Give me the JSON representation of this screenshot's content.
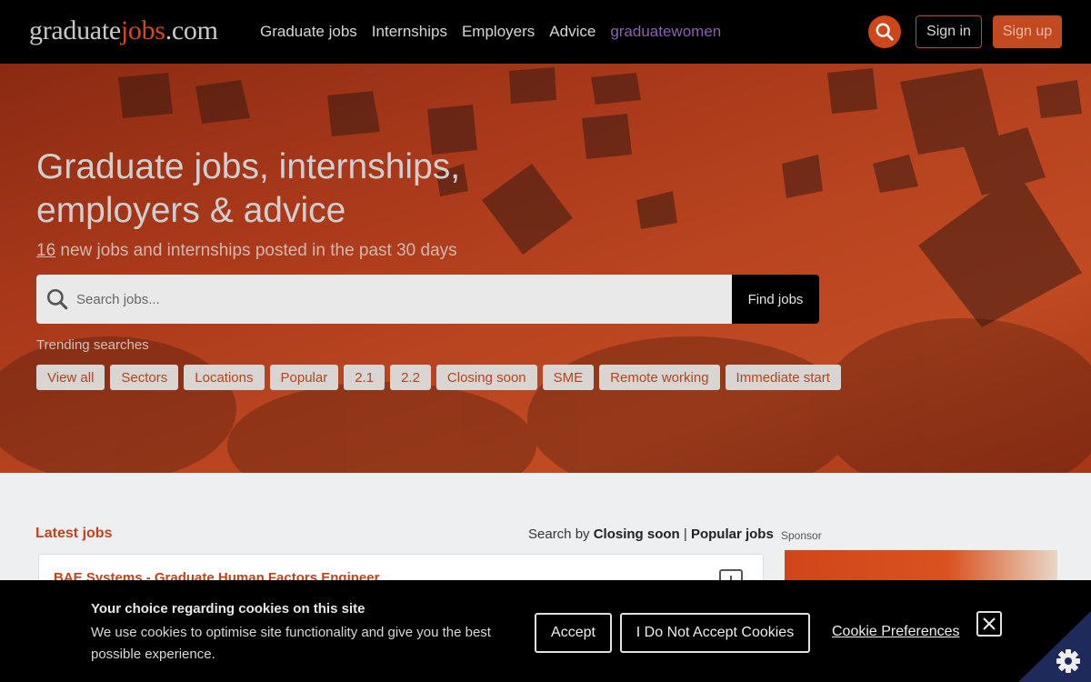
{
  "header": {
    "logo": {
      "part1": "graduate",
      "part2": "jobs",
      "part3": ".com"
    },
    "nav": [
      "Graduate jobs",
      "Internships",
      "Employers",
      "Advice",
      "graduatewomen"
    ],
    "sign_in": "Sign in",
    "sign_up": "Sign up"
  },
  "hero": {
    "title": "Graduate jobs, internships, employers & advice",
    "sub_count": "16",
    "sub_text": " new jobs and internships posted in the past 30 days",
    "search_placeholder": "Search jobs...",
    "find_button": "Find jobs",
    "trending_label": "Trending searches",
    "chips": [
      "View all",
      "Sectors",
      "Locations",
      "Popular",
      "2.1",
      "2.2",
      "Closing soon",
      "SME",
      "Remote working",
      "Immediate start"
    ]
  },
  "latest": {
    "title": "Latest jobs",
    "search_by_prefix": "Search by ",
    "closing_soon": "Closing soon",
    "separator": " | ",
    "popular_jobs": "Popular jobs",
    "sponsor_label": "Sponsor",
    "first_job": "BAE Systems - Graduate Human Factors Engineer"
  },
  "cookie": {
    "title": "Your choice regarding cookies on this site",
    "text": "We use cookies to optimise site functionality and give you the best possible experience.",
    "accept": "Accept",
    "decline": "I Do Not Accept Cookies",
    "preferences": "Cookie Preferences"
  },
  "colors": {
    "brand": "#d0461b",
    "header_bg": "#000000",
    "women": "#8d5fb1"
  },
  "icons": {
    "search": "search-icon",
    "close": "close-icon",
    "gear": "gear-icon",
    "save": "plus-icon"
  }
}
